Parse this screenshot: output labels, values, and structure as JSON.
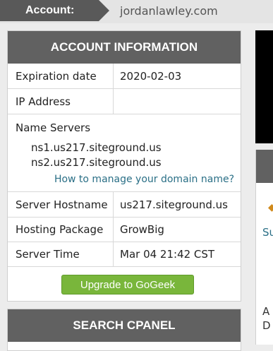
{
  "account_bar": {
    "label": "Account:",
    "domain": "jordanlawley.com"
  },
  "account_info": {
    "title": "ACCOUNT INFORMATION",
    "expiration": {
      "label": "Expiration date",
      "value": "2020-02-03"
    },
    "ip": {
      "label": "IP Address",
      "value": ""
    },
    "name_servers": {
      "label": "Name Servers",
      "ns1": "ns1.us217.siteground.us",
      "ns2": "ns2.us217.siteground.us",
      "link": "How to manage your domain name?"
    },
    "hostname": {
      "label": "Server Hostname",
      "value": "us217.siteground.us"
    },
    "package": {
      "label": "Hosting Package",
      "value": "GrowBig"
    },
    "time": {
      "label": "Server Time",
      "value": "Mar 04 21:42 CST"
    },
    "upgrade_button": "Upgrade to GoGeek"
  },
  "search_cpanel": {
    "title": "SEARCH CPANEL"
  },
  "right_column": {
    "text_1": "Su",
    "text_2": "A",
    "text_3": "D"
  },
  "colors": {
    "header_bg": "#616161",
    "account_label_bg": "#595959",
    "link": "#2a6f86",
    "button_green": "#79b63b"
  }
}
